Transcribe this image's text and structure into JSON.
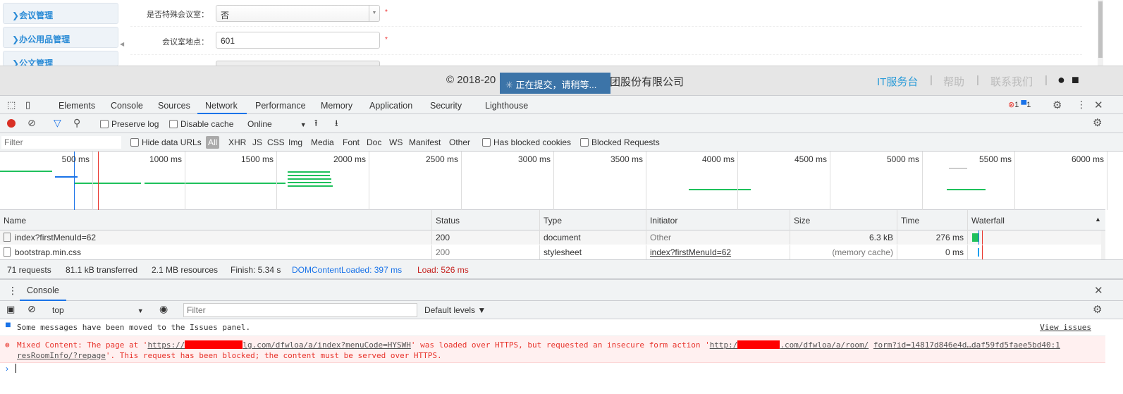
{
  "sidebar": {
    "items": [
      {
        "label": "会议管理"
      },
      {
        "label": "办公用品管理"
      },
      {
        "label": "公文管理"
      }
    ]
  },
  "form": {
    "special_room_label": "是否特殊会议室：",
    "special_room_value": "否",
    "location_label": "会议室地点：",
    "location_value": "601",
    "required_mark": "*"
  },
  "footer": {
    "copyright_left": "© 2018-20",
    "copyright_right": "团股份有限公司",
    "links": [
      "IT服务台",
      "帮助",
      "联系我们"
    ],
    "separator": "|"
  },
  "loading": {
    "text": "正在提交，请稍等..."
  },
  "devtools": {
    "tabs": [
      "Elements",
      "Console",
      "Sources",
      "Network",
      "Performance",
      "Memory",
      "Application",
      "Security",
      "Lighthouse"
    ],
    "active_tab": "Network",
    "error_count": "1",
    "issue_count": "1",
    "toolbar": {
      "preserve_log": "Preserve log",
      "disable_cache": "Disable cache",
      "throttle": "Online"
    },
    "filter": {
      "placeholder": "Filter",
      "hide_data_urls": "Hide data URLs",
      "types": [
        "All",
        "XHR",
        "JS",
        "CSS",
        "Img",
        "Media",
        "Font",
        "Doc",
        "WS",
        "Manifest",
        "Other"
      ],
      "has_blocked_cookies": "Has blocked cookies",
      "blocked_requests": "Blocked Requests"
    },
    "timeline_ticks": [
      "500 ms",
      "1000 ms",
      "1500 ms",
      "2000 ms",
      "2500 ms",
      "3000 ms",
      "3500 ms",
      "4000 ms",
      "4500 ms",
      "5000 ms",
      "5500 ms",
      "6000 ms"
    ],
    "table": {
      "headers": [
        "Name",
        "Status",
        "Type",
        "Initiator",
        "Size",
        "Time",
        "Waterfall"
      ],
      "rows": [
        {
          "name": "index?firstMenuId=62",
          "status": "200",
          "type": "document",
          "initiator": "Other",
          "size": "6.3 kB",
          "time": "276 ms"
        },
        {
          "name": "bootstrap.min.css",
          "status": "200",
          "type": "stylesheet",
          "initiator": "index?firstMenuId=62",
          "size": "(memory cache)",
          "time": "0 ms"
        }
      ]
    },
    "summary": {
      "requests": "71 requests",
      "transferred": "81.1 kB transferred",
      "resources": "2.1 MB resources",
      "finish": "Finish: 5.34 s",
      "dcl": "DOMContentLoaded: 397 ms",
      "load": "Load: 526 ms"
    },
    "console": {
      "tab": "Console",
      "context": "top",
      "filter_placeholder": "Filter",
      "levels": "Default levels ▼",
      "info_message": "Some messages have been moved to the Issues panel.",
      "view_issues": "View issues",
      "error": {
        "prefix": "Mixed Content: The page at '",
        "url1_start": "https://",
        "url1_end": "lg.com/dfwloa/a/index?menuCode=HYSWH",
        "mid": "' was loaded over HTTPS, but requested an insecure form action '",
        "url2_start": "http:/",
        "url2_end": ".com/dfwloa/a/room/",
        "source": "form?id=14817d846e4d…daf59fd5faee5bd40:1",
        "line2_link": "resRoomInfo/?repage",
        "suffix": "'. This request has been blocked; the content must be served over HTTPS."
      }
    }
  },
  "colors": {
    "accent": "#1a73e8",
    "error": "#e8332b",
    "dcl": "#1a73e8",
    "load": "#c5221f",
    "sidebar_text": "#2a8bd6",
    "loading_bg": "#3c74a8"
  }
}
